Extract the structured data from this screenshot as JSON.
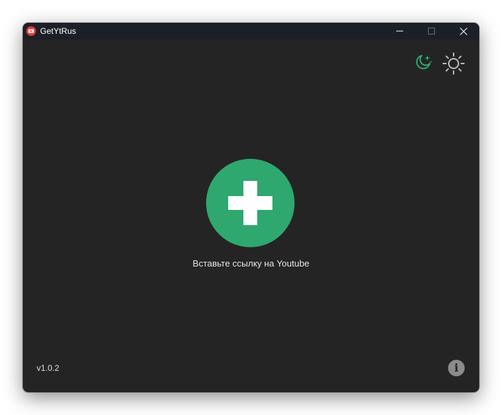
{
  "titlebar": {
    "title": "GetYtRus",
    "icon": "youtube-icon",
    "controls": [
      "minimize-icon",
      "maximize-icon",
      "close-icon"
    ]
  },
  "theme": {
    "dark_icon": "moon-stars-icon",
    "light_icon": "sun-icon",
    "active": "dark",
    "accent_color": "#2ea86e"
  },
  "main": {
    "add_icon": "plus-icon",
    "hint": "Вставьте ссылку на Youtube"
  },
  "footer": {
    "version": "v1.0.2",
    "info_glyph": "i",
    "info_icon": "info-icon"
  },
  "colors": {
    "background": "#242424",
    "titlebar": "#1b1f27",
    "accent": "#2ea86e",
    "youtube_red": "#e53935"
  }
}
